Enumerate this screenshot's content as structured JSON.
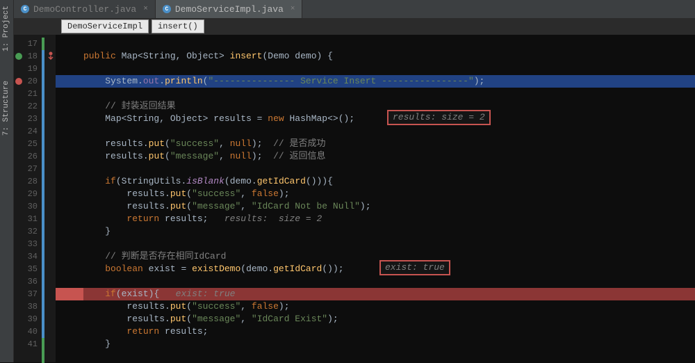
{
  "sidebar": {
    "tabs": [
      {
        "id": "project",
        "label": "1: Project",
        "icon": "folder-icon"
      },
      {
        "id": "structure",
        "label": "7: Structure",
        "icon": "structure-icon"
      }
    ]
  },
  "tabs": [
    {
      "label": "DemoController.java",
      "active": false
    },
    {
      "label": "DemoServiceImpl.java",
      "active": true
    }
  ],
  "breadcrumbs": [
    "DemoServiceImpl",
    "insert()"
  ],
  "gutter_lines": [
    "17",
    "18",
    "19",
    "20",
    "21",
    "22",
    "23",
    "24",
    "25",
    "26",
    "27",
    "28",
    "29",
    "30",
    "31",
    "32",
    "33",
    "34",
    "35",
    "36",
    "37",
    "38",
    "39",
    "40",
    "41"
  ],
  "gutter_marks": {
    "18": "breakpoint",
    "20": "stop"
  },
  "hints": {
    "hint1": "results:  size = 2",
    "hint2": "exist: true",
    "hint3_inline": "results:  size = 2",
    "hint4_inline": "exist: true"
  },
  "code": {
    "l18": {
      "kw1": "public ",
      "type1": "Map<String",
      "punct1": ", ",
      "type2": "Object> ",
      "method": "insert",
      "punct2": "(",
      "type3": "Demo ",
      "var": "demo",
      "punct3": ") {"
    },
    "l20": {
      "type1": "System",
      "punct1": ".",
      "var1": "out",
      "punct2": ".",
      "method": "println",
      "punct3": "(",
      "str": "\"--------------- Service Insert ----------------\"",
      "punct4": ");"
    },
    "l22": {
      "comment": "// 封装返回结果"
    },
    "l23": {
      "type1": "Map<String",
      "punct1": ", ",
      "type2": "Object> ",
      "var": "results",
      "punct2": " = ",
      "kw": "new ",
      "type3": "HashMap<>",
      "punct3": "();"
    },
    "l25": {
      "var": "results",
      "punct1": ".",
      "method": "put",
      "punct2": "(",
      "str": "\"success\"",
      "punct3": ", ",
      "kw": "null",
      "punct4": ");",
      "comment": "  // 是否成功"
    },
    "l26": {
      "var": "results",
      "punct1": ".",
      "method": "put",
      "punct2": "(",
      "str": "\"message\"",
      "punct3": ", ",
      "kw": "null",
      "punct4": ");",
      "comment": "  // 返回信息"
    },
    "l28": {
      "kw1": "if",
      "punct1": "(",
      "type": "StringUtils",
      "punct2": ".",
      "method": "isBlank",
      "punct3": "(",
      "var": "demo",
      "punct4": ".",
      "method2": "getIdCard",
      "punct5": "())){"
    },
    "l29": {
      "var": "results",
      "punct1": ".",
      "method": "put",
      "punct2": "(",
      "str": "\"success\"",
      "punct3": ", ",
      "kw": "false",
      "punct4": ");"
    },
    "l30": {
      "var": "results",
      "punct1": ".",
      "method": "put",
      "punct2": "(",
      "str": "\"message\"",
      "punct3": ", ",
      "str2": "\"IdCard Not be Null\"",
      "punct4": ");"
    },
    "l31": {
      "kw": "return ",
      "var": "results",
      "punct": ";"
    },
    "l32": {
      "punct": "}"
    },
    "l34": {
      "comment": "// 判断是否存在相同IdCard"
    },
    "l35": {
      "kw1": "boolean ",
      "var1": "exist",
      "punct1": " = ",
      "method": "existDemo",
      "punct2": "(",
      "var2": "demo",
      "punct3": ".",
      "method2": "getIdCard",
      "punct4": "());"
    },
    "l37": {
      "kw": "if",
      "punct1": "(",
      "var": "exist",
      "punct2": "){"
    },
    "l38": {
      "var": "results",
      "punct1": ".",
      "method": "put",
      "punct2": "(",
      "str": "\"success\"",
      "punct3": ", ",
      "kw": "false",
      "punct4": ");"
    },
    "l39": {
      "var": "results",
      "punct1": ".",
      "method": "put",
      "punct2": "(",
      "str": "\"message\"",
      "punct3": ", ",
      "str2": "\"IdCard Exist\"",
      "punct4": ");"
    },
    "l40": {
      "kw": "return ",
      "var": "results",
      "punct": ";"
    },
    "l41": {
      "punct": "}"
    }
  }
}
